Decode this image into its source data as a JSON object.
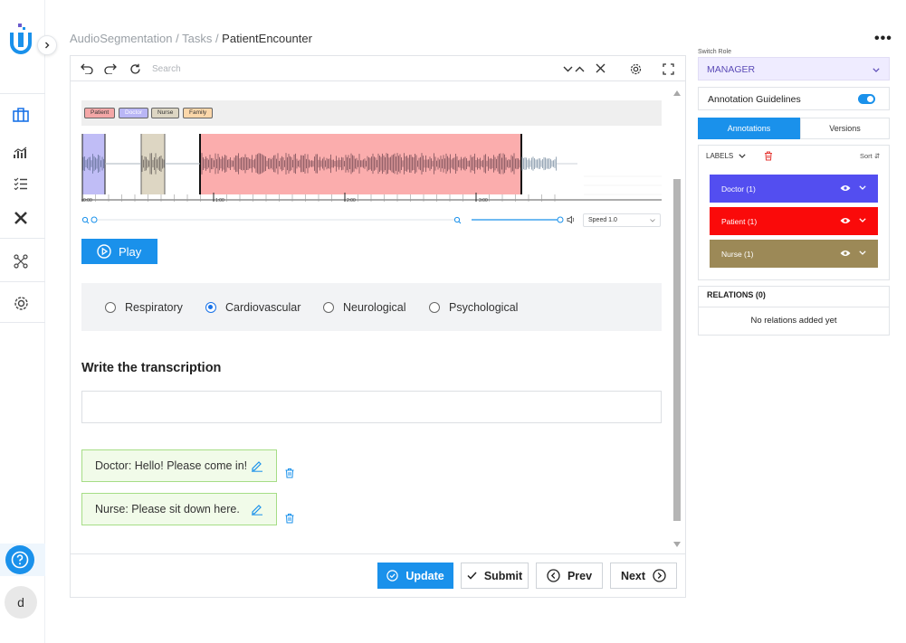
{
  "breadcrumb": {
    "project": "AudioSegmentation",
    "sep1": " / ",
    "section": "Tasks",
    "sep2": " / ",
    "current": "PatientEncounter"
  },
  "toolbar": {
    "search_placeholder": "Search"
  },
  "audio": {
    "label_chips": [
      {
        "label": "Patient",
        "color": "#f4a7a7"
      },
      {
        "label": "Doctor",
        "color": "#b9b6f5"
      },
      {
        "label": "Nurse",
        "color": "#ddd6c3"
      },
      {
        "label": "Family",
        "color": "#fbd7aa"
      }
    ],
    "time_labels": [
      "0:00",
      "1:00",
      "2:00",
      "3:00"
    ],
    "speed_label": "Speed 1.0",
    "play_label": "Play"
  },
  "classification": {
    "options": [
      "Respiratory",
      "Cardiovascular",
      "Neurological",
      "Psychological"
    ],
    "selected": "Cardiovascular"
  },
  "transcription": {
    "heading": "Write the transcription",
    "input_value": "",
    "items": [
      "Doctor: Hello! Please come in!",
      "Nurse: Please sit down here."
    ]
  },
  "footer": {
    "update": "Update",
    "submit": "Submit",
    "prev": "Prev",
    "next": "Next"
  },
  "right_panel": {
    "switch_role_label": "Switch Role",
    "role": "MANAGER",
    "guidelines_label": "Annotation Guidelines",
    "guidelines_enabled": true,
    "tabs": [
      "Annotations",
      "Versions"
    ],
    "labels_header": "LABELS",
    "sort_label": "Sort",
    "labels": [
      {
        "name": "Doctor (1)",
        "color": "#534ef0"
      },
      {
        "name": "Patient (1)",
        "color": "#fa0a0a"
      },
      {
        "name": "Nurse (1)",
        "color": "#9c8957"
      }
    ],
    "relations_title": "RELATIONS (0)",
    "relations_empty": "No relations added yet"
  },
  "user": {
    "avatar_initial": "d"
  },
  "colors": {
    "accent": "#1a91eb"
  }
}
